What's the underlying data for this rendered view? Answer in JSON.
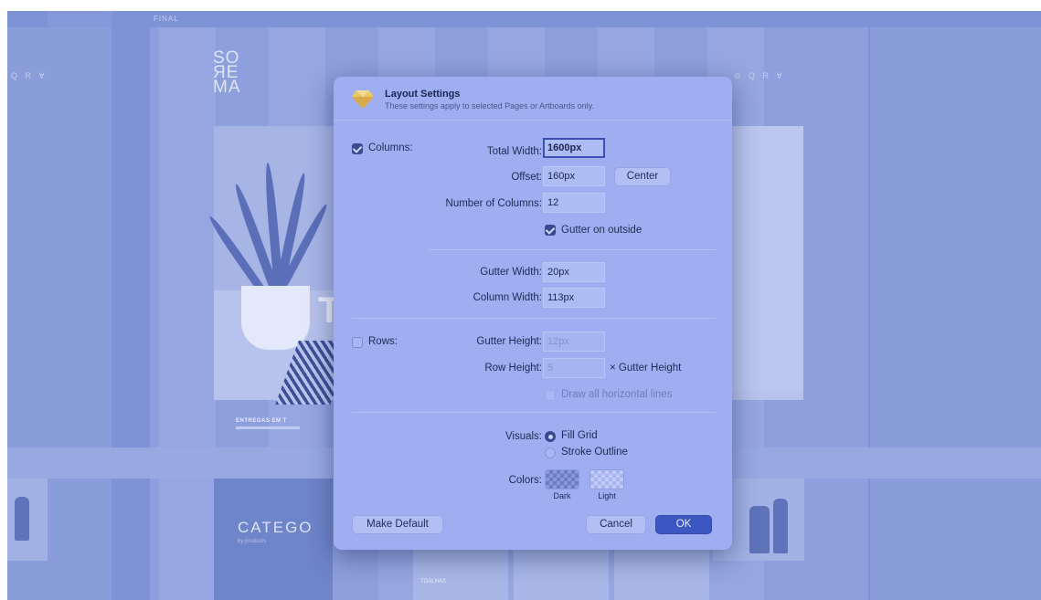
{
  "canvas": {
    "artboard_name": "FINAL",
    "logo_lines": [
      "SO",
      "ЯE",
      "MA"
    ],
    "left_icons": "Q R ∀",
    "right_icons": "⊖ Q R ∀",
    "hero_letter": "T",
    "strip_title": "ENTREGAS EM T",
    "category_title": "CATEGO",
    "category_sub": "by products",
    "thumb_label": "TOALHAS"
  },
  "dialog": {
    "icon": "sketch-diamond-icon",
    "title": "Layout Settings",
    "subtitle": "These settings apply to selected Pages or Artboards only.",
    "columns": {
      "label": "Columns:",
      "checked": true,
      "total_width_label": "Total Width:",
      "total_width_value": "1600px",
      "offset_label": "Offset:",
      "offset_value": "160px",
      "center_button": "Center",
      "number_label": "Number of Columns:",
      "number_value": "12",
      "gutter_outside_label": "Gutter on outside",
      "gutter_outside_checked": true,
      "gutter_width_label": "Gutter Width:",
      "gutter_width_value": "20px",
      "column_width_label": "Column Width:",
      "column_width_value": "113px"
    },
    "rows": {
      "label": "Rows:",
      "checked": false,
      "gutter_height_label": "Gutter Height:",
      "gutter_height_value": "12px",
      "row_height_label": "Row Height:",
      "row_height_value": "5",
      "row_height_suffix": "× Gutter Height",
      "draw_lines_label": "Draw all horizontal lines",
      "draw_lines_checked": false
    },
    "visuals": {
      "label": "Visuals:",
      "options": [
        "Fill Grid",
        "Stroke Outline"
      ],
      "selected": "Fill Grid"
    },
    "colors": {
      "label": "Colors:",
      "dark_label": "Dark",
      "light_label": "Light"
    },
    "buttons": {
      "make_default": "Make Default",
      "cancel": "Cancel",
      "ok": "OK"
    }
  },
  "theme": {
    "overlay": "#7e92d6",
    "dialog_bg": "#9eaef1",
    "accent": "#3c56c2"
  }
}
